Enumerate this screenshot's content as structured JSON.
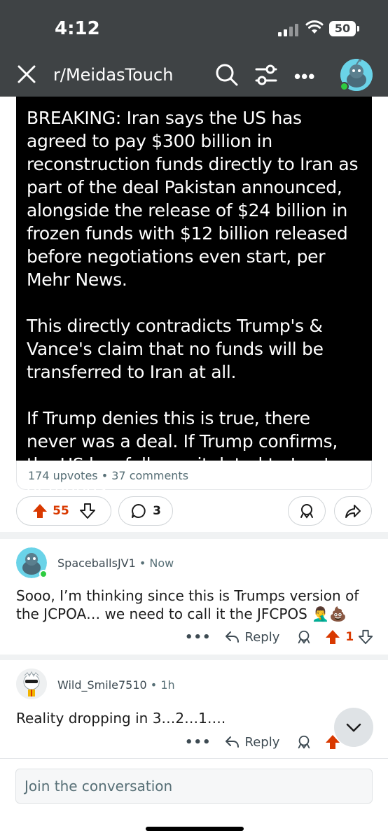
{
  "status_bar": {
    "time": "4:12",
    "battery": "50"
  },
  "header": {
    "subreddit": "r/MeidasTouch"
  },
  "post": {
    "image_text": [
      "BREAKING: Iran says the US has agreed to pay $300 billion in reconstruction funds directly to Iran as part of the deal Pakistan announced, alongside the release of $24 billion in frozen funds with $12 billion released before negotiations even start, per Mehr News.",
      "This directly contradicts Trump's & Vance's claim that no funds will be transferred to Iran at all.",
      "If Trump denies this is true, there never was a deal. If Trump confirms, the US has fully capitulated to Iran's demands."
    ],
    "stats": "174 upvotes • 37 comments",
    "vote_count": "55",
    "comment_count": "3"
  },
  "comments": [
    {
      "author": "SpaceballsJV1",
      "meta": " • Now",
      "body": "Sooo, I’m thinking since this is Trumps version of the JCPOA… we need to call it the JFCPOS 🤦‍♂️💩",
      "reply_label": "Reply",
      "score": "1",
      "more": "•••"
    },
    {
      "author": "Wild_Smile7510",
      "meta": " • 1h",
      "body": "Reality dropping in 3…2…1….",
      "reply_label": "Reply",
      "more": "•••"
    }
  ],
  "composer": {
    "placeholder": "Join the conversation"
  },
  "colors": {
    "header_bg": "#3f4345",
    "upvote": "#d93900",
    "accent": "#6ad3e8"
  }
}
